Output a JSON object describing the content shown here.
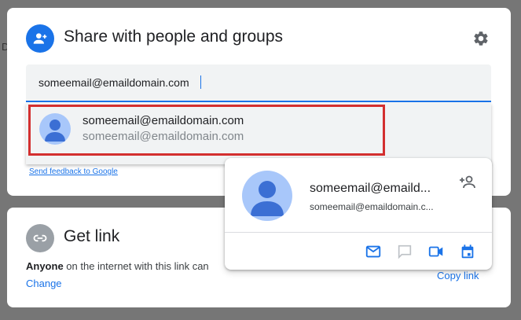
{
  "background_fragment": "D",
  "share": {
    "title": "Share with people and groups",
    "input_value": "someemail@emaildomain.com",
    "suggestion": {
      "name": "someemail@emaildomain.com",
      "email": "someemail@emaildomain.com"
    },
    "feedback_label": "Send feedback to Google"
  },
  "link": {
    "title": "Get link",
    "desc_bold": "Anyone",
    "desc_rest": " on the internet with this link can",
    "change_label": "Change",
    "copy_label": "Copy link"
  },
  "hovercard": {
    "name": "someemail@emaild...",
    "email": "someemail@emaildomain.c..."
  },
  "colors": {
    "accent": "#1a73e8",
    "highlight_border": "#d32f2f",
    "avatar_bg": "#a8c7fa",
    "avatar_fg": "#4a7fd8"
  },
  "icons": {
    "share": "person-add-icon",
    "settings": "gear-icon",
    "link": "link-icon",
    "add_person": "person-add-icon",
    "email": "mail-icon",
    "chat": "chat-icon",
    "video": "video-icon",
    "calendar": "calendar-icon"
  }
}
